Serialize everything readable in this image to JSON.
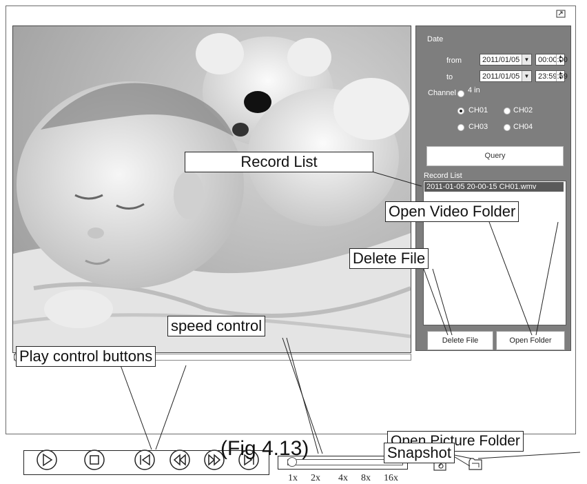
{
  "panel": {
    "date_label": "Date",
    "from_label": "from",
    "from_date": "2011/01/05",
    "from_time": "00:00:00",
    "to_label": "to",
    "to_date": "2011/01/05",
    "to_time": "23:59:59",
    "channel_label": "Channel",
    "channels": {
      "four_in": "4 in",
      "ch1": "CH01",
      "ch2": "CH02",
      "ch3": "CH03",
      "ch4": "CH04"
    },
    "selected_channel": "CH01",
    "query_button": "Query",
    "record_list_label": "Record List",
    "records": [
      "2011-01-05 20-00-15 CH01.wmv"
    ],
    "delete_button": "Delete File",
    "open_folder_button": "Open Folder"
  },
  "playback": {
    "speeds": [
      "1x",
      "2x",
      "4x",
      "8x",
      "16x"
    ],
    "controls": [
      "play-icon",
      "stop-icon",
      "skip-back-icon",
      "rewind-icon",
      "fast-forward-icon",
      "skip-forward-icon"
    ]
  },
  "callouts": {
    "record_list": "Record List",
    "open_video_folder": "Open Video Folder",
    "delete_file": "Delete File",
    "speed_control": "speed control",
    "play_control_buttons": "Play control buttons",
    "open_picture_folder": "Open Picture Folder",
    "snapshot": "Snapshot"
  },
  "figure_caption": "(Fig 4.13)"
}
